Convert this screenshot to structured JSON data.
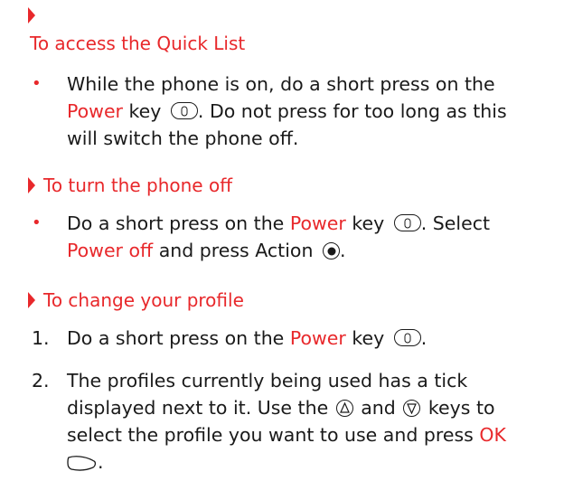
{
  "sections": [
    {
      "heading": "To access the Quick List",
      "items": [
        {
          "lines": [
            {
              "pre": "While the phone is on, do a short press on the"
            },
            {
              "red": "Power",
              "mid": " key",
              "icon": "power-key-icon",
              "post": ". Do not press for too long as this"
            },
            {
              "pre": "will switch the phone off."
            }
          ]
        }
      ]
    },
    {
      "heading": "To turn the phone off",
      "items": [
        {
          "lines": [
            {
              "pre": "Do a short press on the ",
              "red": "Power",
              "mid": " key",
              "icon": "power-key-icon",
              "post": ". Select"
            },
            {
              "red": "Power off",
              "mid": " and press Action",
              "icon": "action-key-icon",
              "post": "."
            }
          ]
        }
      ]
    },
    {
      "heading": "To change your profile",
      "items": [
        {
          "number": "1.",
          "lines": [
            {
              "pre": "Do a short press on the ",
              "red": "Power",
              "mid": " key",
              "icon": "power-key-icon",
              "post": "."
            }
          ]
        },
        {
          "number": "2.",
          "lines": [
            {
              "pre": "The profiles currently being used has a tick"
            },
            {
              "pre": "displayed next to it. Use the",
              "icon1": "up-key-icon",
              "mid": "and",
              "icon2": "down-key-icon",
              "post": "keys to"
            },
            {
              "pre": "select the profile you want to use and press ",
              "red": "OK"
            },
            {
              "icon": "ok-key-icon",
              "post": "."
            }
          ]
        }
      ]
    }
  ]
}
